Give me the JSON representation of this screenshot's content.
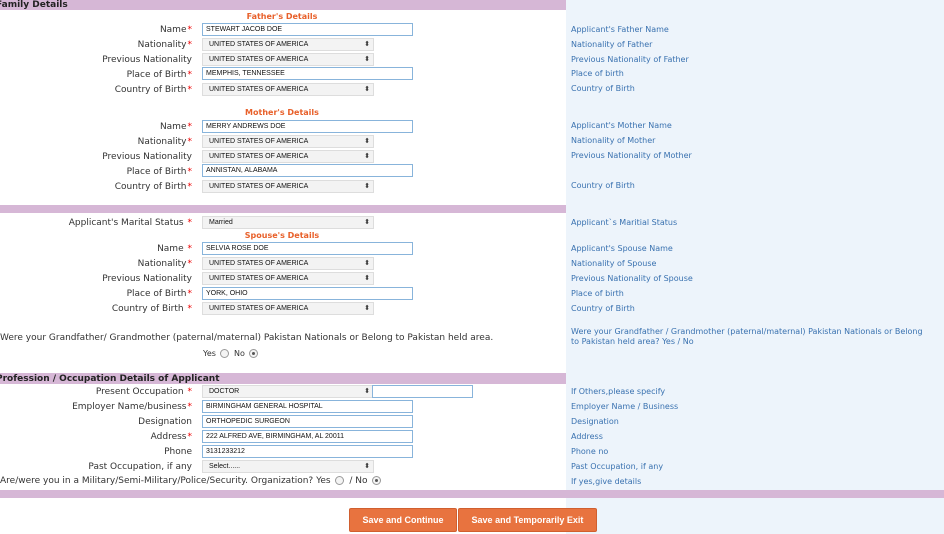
{
  "family": {
    "section_title": "Family Details",
    "father_heading": "Father's Details",
    "mother_heading": "Mother's Details",
    "spouse_heading": "Spouse's Details",
    "father": {
      "name_label": "Name",
      "name": "STEWART JACOB DOE",
      "nationality_label": "Nationality",
      "nationality": "UNITED STATES OF AMERICA",
      "prev_nationality_label": "Previous Nationality",
      "prev_nationality": "UNITED STATES OF AMERICA",
      "pob_label": "Place of Birth",
      "pob": "MEMPHIS, TENNESSEE",
      "cob_label": "Country of Birth",
      "cob": "UNITED STATES OF AMERICA"
    },
    "mother": {
      "name_label": "Name",
      "name": "MERRY ANDREWS DOE",
      "nationality_label": "Nationality",
      "nationality": "UNITED STATES OF AMERICA",
      "prev_nationality_label": "Previous Nationality",
      "prev_nationality": "UNITED STATES OF AMERICA",
      "pob_label": "Place of Birth",
      "pob": "ANNISTAN, ALABAMA",
      "cob_label": "Country of Birth",
      "cob": "UNITED STATES OF AMERICA"
    },
    "marital_label": "Applicant's Marital Status",
    "marital": "Married",
    "spouse": {
      "name_label": "Name",
      "name": "SELVIA ROSE DOE",
      "nationality_label": "Nationality",
      "nationality": "UNITED STATES OF AMERICA",
      "prev_nationality_label": "Previous Nationality",
      "prev_nationality": "UNITED STATES OF AMERICA",
      "pob_label": "Place of Birth",
      "pob": "YORK, OHIO",
      "cob_label": "Country of Birth",
      "cob": "UNITED STATES OF AMERICA"
    },
    "grandparent_question": "Were your Grandfather/ Grandmother (paternal/maternal) Pakistan Nationals or Belong to Pakistan held area.",
    "yes_label": "Yes",
    "no_label": "No",
    "grandparent_answer": "No"
  },
  "hints": {
    "father_name": "Applicant's Father Name",
    "father_nationality": "Nationality of Father",
    "father_prev": "Previous Nationality of Father",
    "father_pob": "Place of birth",
    "father_cob": "Country of Birth",
    "mother_name": "Applicant's Mother Name",
    "mother_nationality": "Nationality of Mother",
    "mother_prev": "Previous Nationality of Mother",
    "mother_cob": "Country of Birth",
    "marital": "Applicant`s Maritial Status",
    "spouse_name": "Applicant's Spouse Name",
    "spouse_nationality": "Nationality of Spouse",
    "spouse_prev": "Previous Nationality of Spouse",
    "spouse_pob": "Place of birth",
    "spouse_cob": "Country of Birth",
    "grandparent_line1": "Were your Grandfather / Grandmother (paternal/maternal) Pakistan Nationals or Belong",
    "grandparent_line2": "to Pakistan held area? Yes / No",
    "occupation_other": "If Others,please specify",
    "employer": "Employer Name / Business",
    "designation": "Designation",
    "address": "Address",
    "phone": "Phone no",
    "past_occupation": "Past Occupation, if any",
    "military": "If yes,give details"
  },
  "profession": {
    "section_title": "Profession / Occupation Details of Applicant",
    "present_label": "Present Occupation",
    "present": "DOCTOR",
    "other_value": "",
    "employer_label": "Employer Name/business",
    "employer": "BIRMINGHAM GENERAL HOSPITAL",
    "designation_label": "Designation",
    "designation": "ORTHOPEDIC SURGEON",
    "address_label": "Address",
    "address": "222 ALFRED AVE, BIRMINGHAM, AL 20011",
    "phone_label": "Phone",
    "phone": "3131233212",
    "past_label": "Past Occupation, if any",
    "past": "Select......",
    "military_question": "Are/were you in a Military/Semi-Military/Police/Security. Organization? Yes",
    "military_no": "/ No",
    "military_answer": "No"
  },
  "actions": {
    "save_continue": "Save and Continue",
    "save_exit": "Save and Temporarily Exit"
  }
}
